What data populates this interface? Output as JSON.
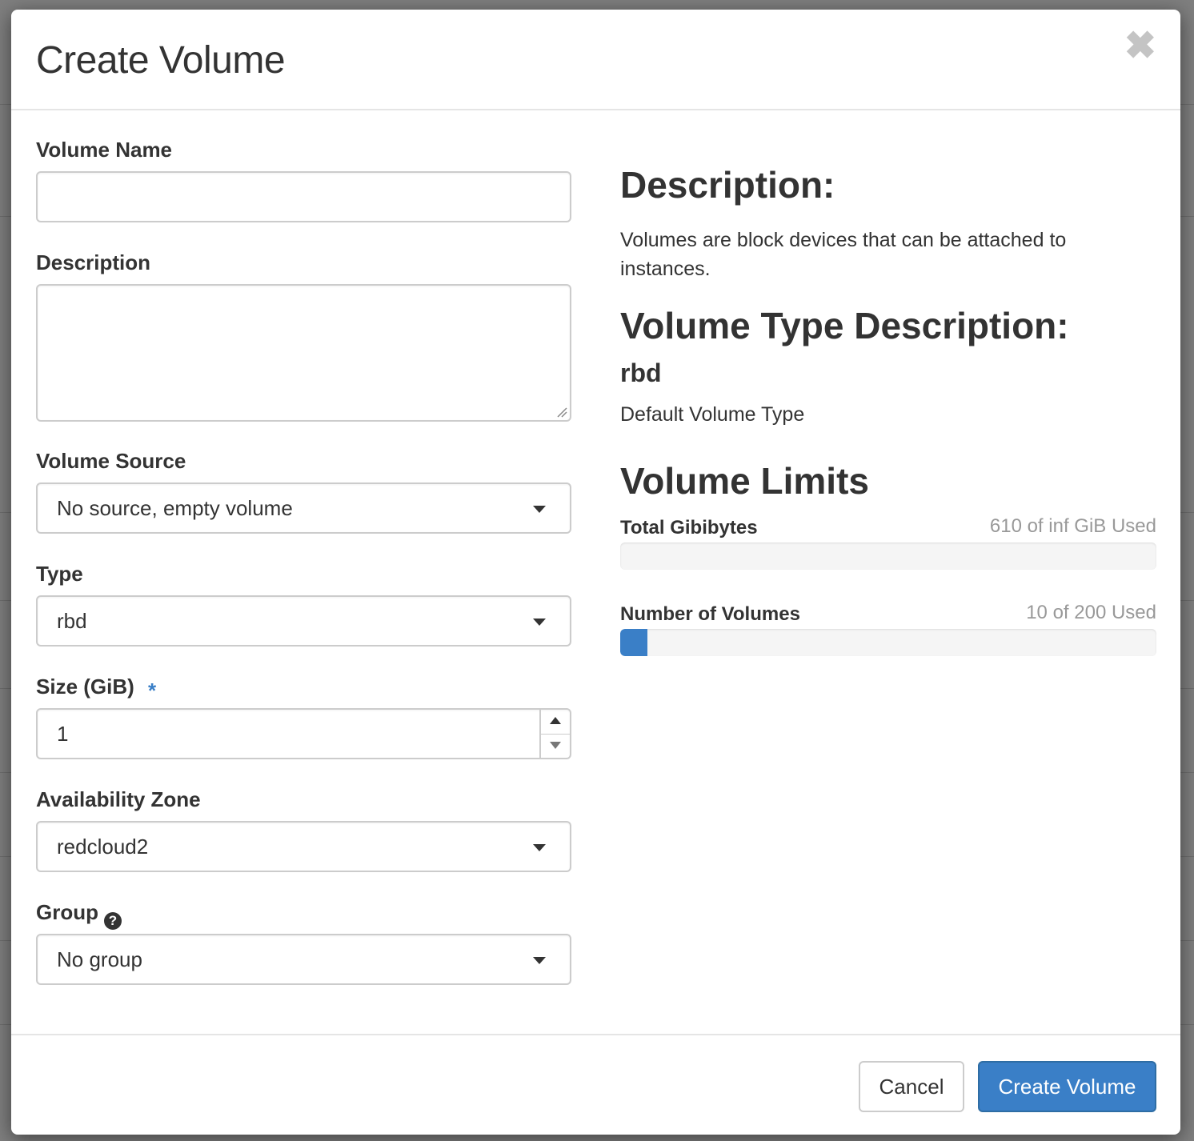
{
  "modal": {
    "title": "Create Volume",
    "close_symbol": "✖"
  },
  "form": {
    "volume_name": {
      "label": "Volume Name",
      "value": ""
    },
    "description": {
      "label": "Description",
      "value": ""
    },
    "volume_source": {
      "label": "Volume Source",
      "selected": "No source, empty volume"
    },
    "type": {
      "label": "Type",
      "selected": "rbd"
    },
    "size": {
      "label": "Size (GiB)",
      "required_marker": "*",
      "value": "1"
    },
    "availability_zone": {
      "label": "Availability Zone",
      "selected": "redcloud2"
    },
    "group": {
      "label": "Group",
      "help_symbol": "?",
      "selected": "No group"
    }
  },
  "info": {
    "description_heading": "Description:",
    "description_text": "Volumes are block devices that can be attached to instances.",
    "volume_type_heading": "Volume Type Description:",
    "volume_type_name": "rbd",
    "volume_type_text": "Default Volume Type",
    "limits_heading": "Volume Limits",
    "limits": [
      {
        "label": "Total Gibibytes",
        "used_text": "610 of inf GiB Used",
        "fraction": 0
      },
      {
        "label": "Number of Volumes",
        "used_text": "10 of 200 Used",
        "fraction": 0.05
      }
    ]
  },
  "footer": {
    "cancel_label": "Cancel",
    "submit_label": "Create Volume"
  },
  "colors": {
    "primary": "#3a7fc7",
    "required": "#3a7fc7",
    "overlay": "#7a7a7a"
  },
  "icons": [
    "close-icon",
    "chevron-down-icon",
    "help-icon",
    "spinner-up-icon",
    "spinner-down-icon",
    "resize-grip-icon"
  ]
}
